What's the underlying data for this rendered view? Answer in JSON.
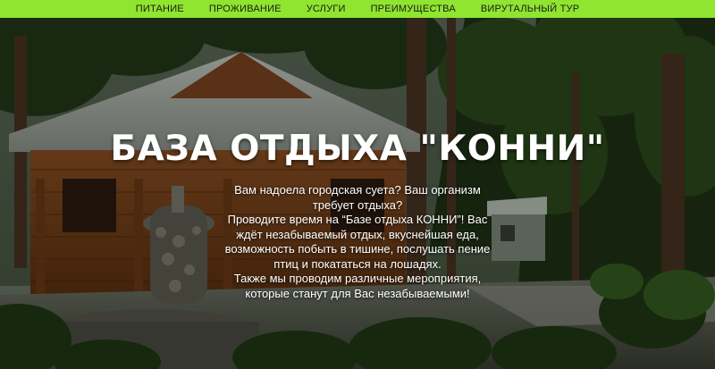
{
  "nav": {
    "items": [
      {
        "label": "ПИТАНИЕ"
      },
      {
        "label": "ПРОЖИВАНИЕ"
      },
      {
        "label": "УСЛУГИ"
      },
      {
        "label": "ПРЕИМУЩЕСТВА"
      },
      {
        "label": "ВИРУТАЛЬНЫЙ ТУР"
      }
    ],
    "background_color": "#8fe52f"
  },
  "hero": {
    "title": "БАЗА ОТДЫХА \"КОННИ\"",
    "description": {
      "line1": "Вам надоела городская суета? Ваш организм требует отдыха?",
      "line2": "Проводите время на “Базе отдыха КОННИ”! Вас ждёт незабываемый отдых, вкуснейшая еда, возможность побыть в тишине, послушать пение птиц и покататься на лошадях.",
      "line3": "Также мы проводим различные мероприятия, которые станут для Вас незабываемыми!"
    }
  }
}
